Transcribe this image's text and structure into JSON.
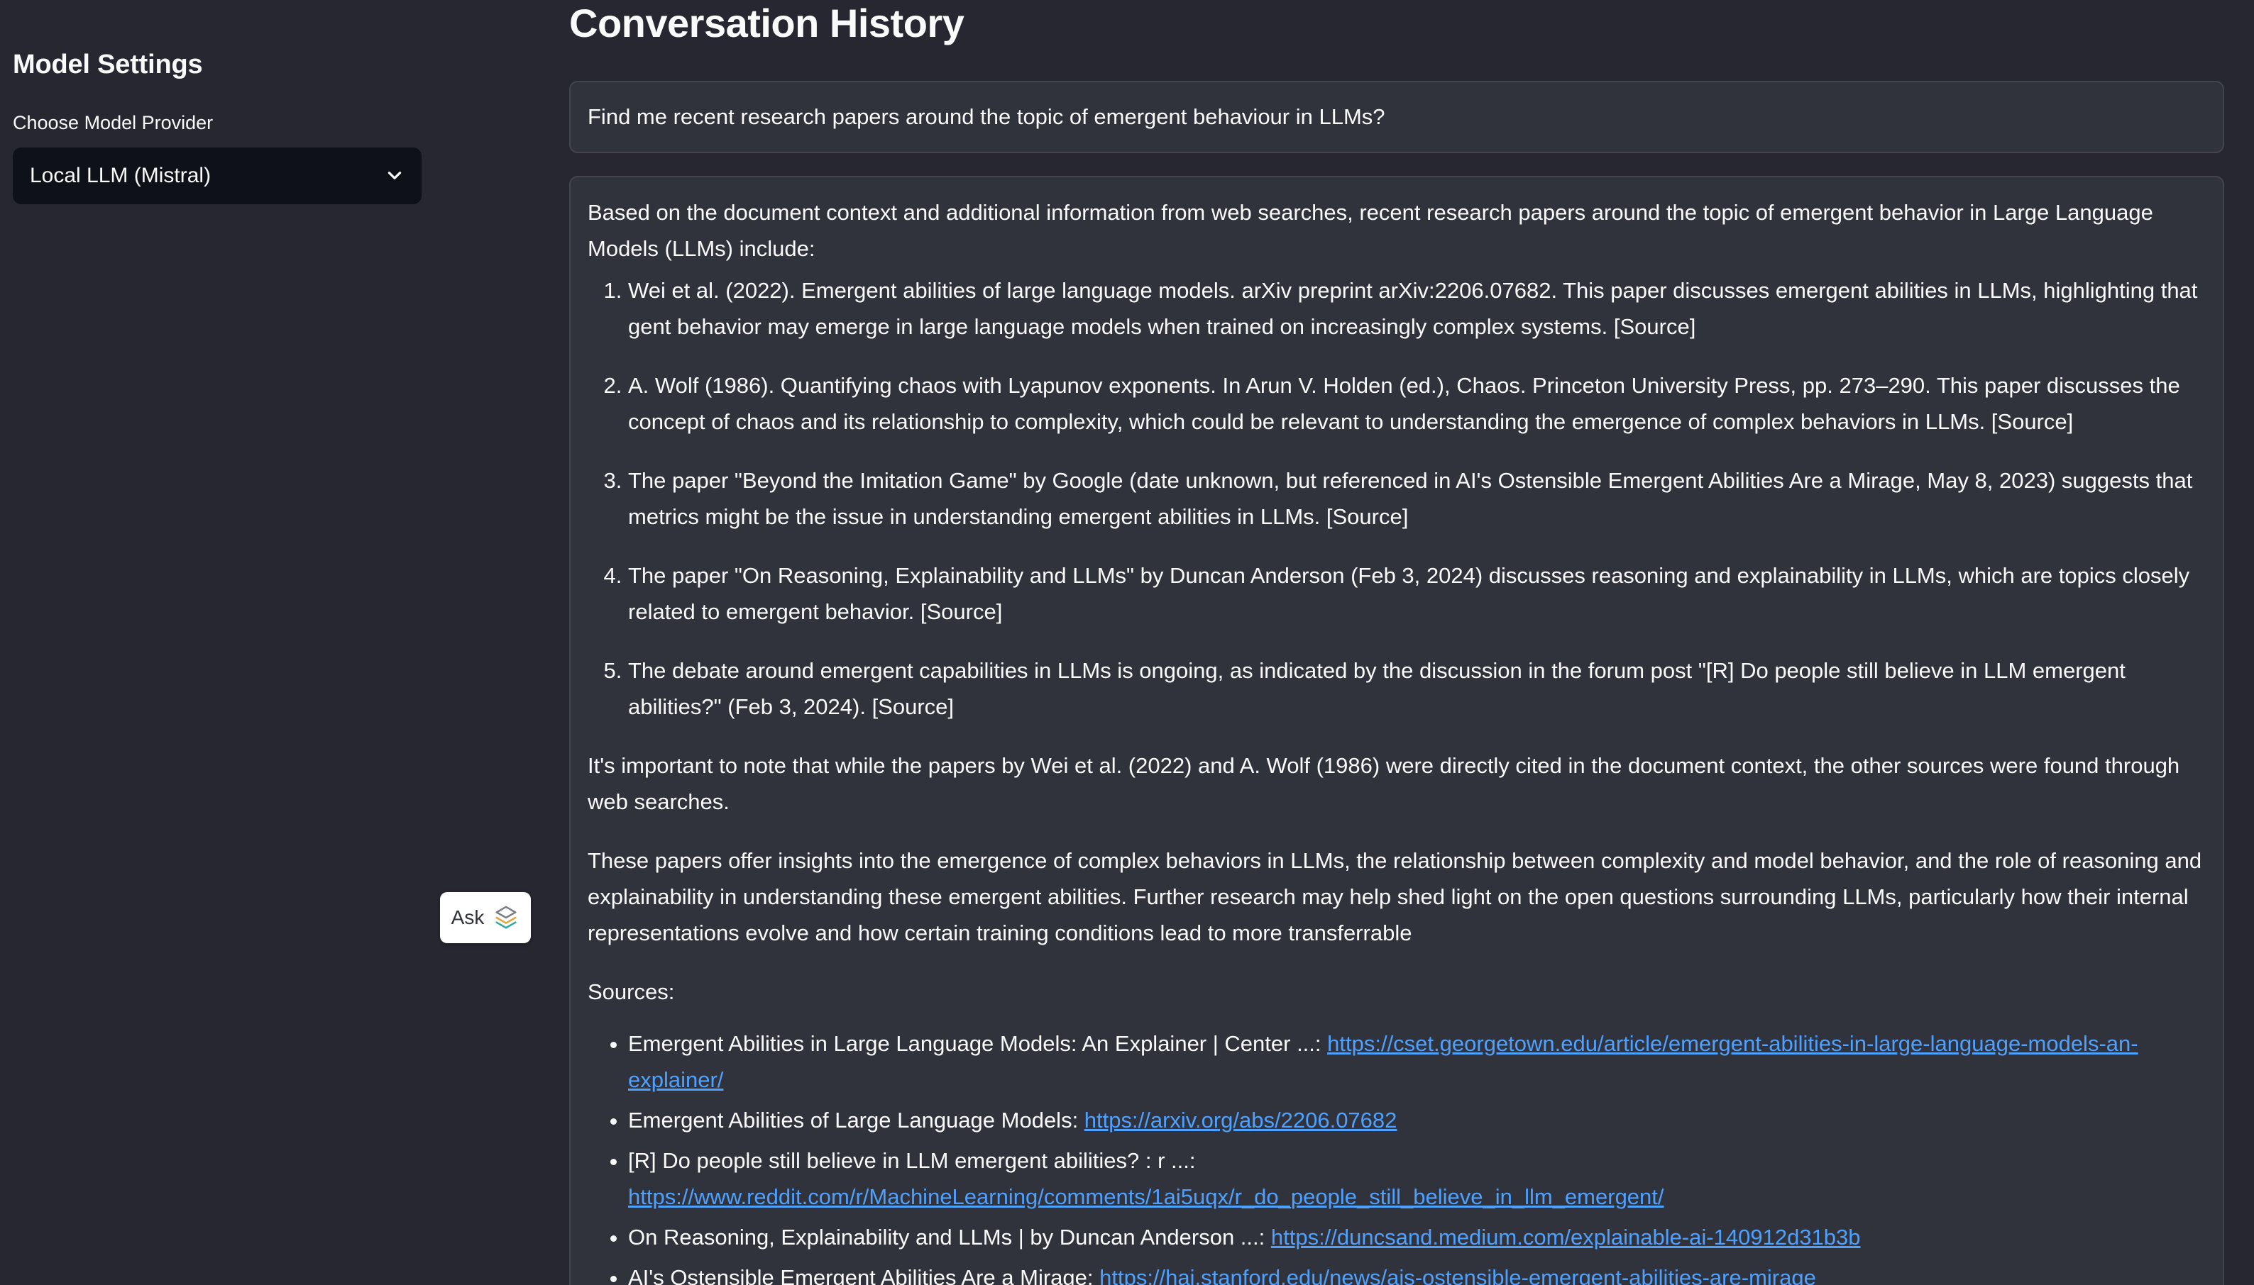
{
  "sidebar": {
    "heading": "Model Settings",
    "provider_label": "Choose Model Provider",
    "provider_selected": "Local LLM (Mistral)"
  },
  "main": {
    "title": "Conversation History",
    "user_message": "Find me recent research papers around the topic of emergent behaviour in LLMs?",
    "assistant": {
      "intro": "Based on the document context and additional information from web searches, recent research papers around the topic of emergent behavior in Large Language Models (LLMs) include:",
      "items": [
        "Wei et al. (2022). Emergent abilities of large language models. arXiv preprint arXiv:2206.07682. This paper discusses emergent abilities in LLMs, highlighting that gent behavior may emerge in large language models when trained on increasingly complex systems. [Source]",
        "A. Wolf (1986). Quantifying chaos with Lyapunov exponents. In Arun V. Holden (ed.), Chaos. Princeton University Press, pp. 273–290. This paper discusses the concept of chaos and its relationship to complexity, which could be relevant to understanding the emergence of complex behaviors in LLMs. [Source]",
        "The paper \"Beyond the Imitation Game\" by Google (date unknown, but referenced in AI's Ostensible Emergent Abilities Are a Mirage, May 8, 2023) suggests that metrics might be the issue in understanding emergent abilities in LLMs. [Source]",
        "The paper \"On Reasoning, Explainability and LLMs\" by Duncan Anderson (Feb 3, 2024) discusses reasoning and explainability in LLMs, which are topics closely related to emergent behavior. [Source]",
        "The debate around emergent capabilities in LLMs is ongoing, as indicated by the discussion in the forum post \"[R] Do people still believe in LLM emergent abilities?\" (Feb 3, 2024). [Source]"
      ],
      "note": "It's important to note that while the papers by Wei et al. (2022) and A. Wolf (1986) were directly cited in the document context, the other sources were found through web searches.",
      "summary": "These papers offer insights into the emergence of complex behaviors in LLMs, the relationship between complexity and model behavior, and the role of reasoning and explainability in understanding these emergent abilities. Further research may help shed light on the open questions surrounding LLMs, particularly how their internal representations evolve and how certain training conditions lead to more transferrable",
      "sources_label": "Sources:",
      "sources": [
        {
          "label": "Emergent Abilities in Large Language Models: An Explainer | Center ...: ",
          "url": "https://cset.georgetown.edu/article/emergent-abilities-in-large-language-models-an-explainer/"
        },
        {
          "label": "Emergent Abilities of Large Language Models: ",
          "url": "https://arxiv.org/abs/2206.07682"
        },
        {
          "label": "[R] Do people still believe in LLM emergent abilities? : r ...: ",
          "url": "https://www.reddit.com/r/MachineLearning/comments/1ai5uqx/r_do_people_still_believe_in_llm_emergent/"
        },
        {
          "label": "On Reasoning, Explainability and LLMs | by Duncan Anderson ...: ",
          "url": "https://duncsand.medium.com/explainable-ai-140912d31b3b"
        },
        {
          "label": "AI's Ostensible Emergent Abilities Are a Mirage: ",
          "url": "https://hai.stanford.edu/news/ais-ostensible-emergent-abilities-are-mirage"
        }
      ]
    }
  },
  "ask_button": {
    "label": "Ask",
    "icon": "layers-logo-icon"
  },
  "colors": {
    "sidebar_bg": "#262730",
    "main_bg": "#262730",
    "chat_bg": "#31333c",
    "text": "#fafafa",
    "link": "#4ea1ff"
  }
}
